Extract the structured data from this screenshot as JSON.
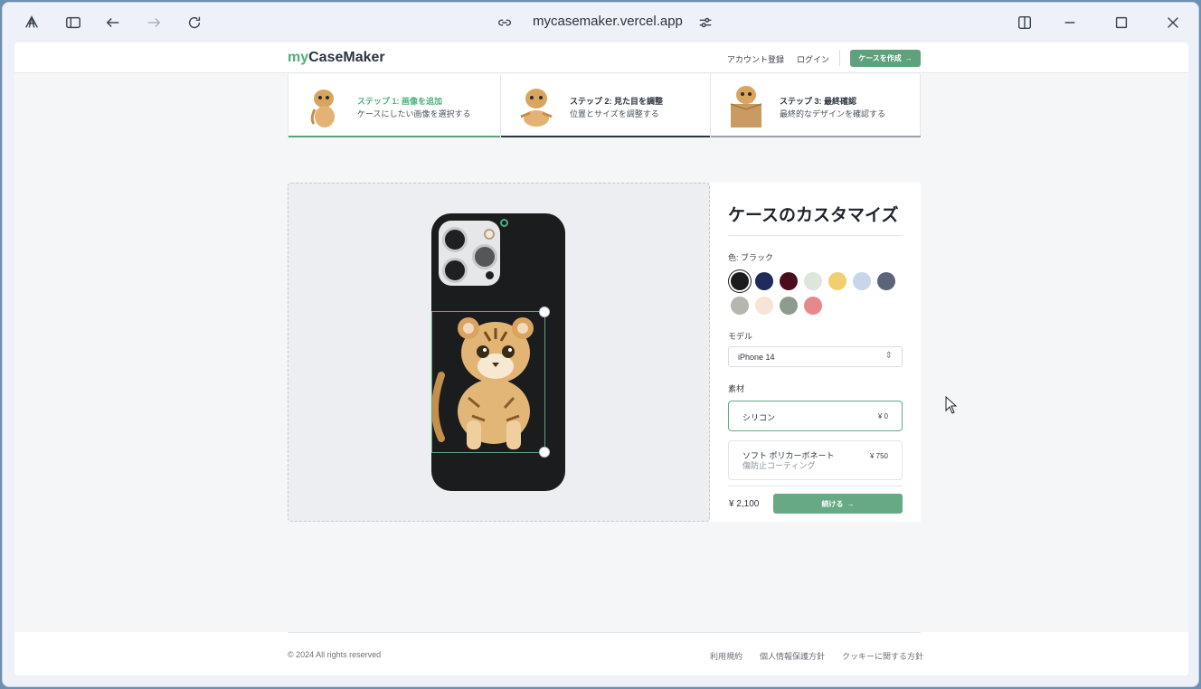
{
  "browser": {
    "url": "mycasemaker.vercel.app"
  },
  "navbar": {
    "logo_prefix": "my",
    "logo_main": "CaseMaker",
    "register_link": "アカウント登録",
    "login_link": "ログイン",
    "create_button": "ケースを作成",
    "create_button_icon": "→"
  },
  "steps": [
    {
      "title": "ステップ 1: 画像を追加",
      "desc": "ケースにしたい画像を選択する",
      "state": "complete",
      "title_color": "#4caf7d",
      "bar_color": "#5ea27d"
    },
    {
      "title": "ステップ 2: 見た目を調整",
      "desc": "位置とサイズを調整する",
      "state": "current",
      "title_color": "#2d3540",
      "bar_color": "#2d3540"
    },
    {
      "title": "ステップ 3: 最終確認",
      "desc": "最終的なデザインを確認する",
      "state": "upcoming",
      "title_color": "#2d3540",
      "bar_color": "#9aa1a9"
    }
  ],
  "panel": {
    "heading": "ケースのカスタマイズ",
    "color_label": "色: ブラック",
    "colors": [
      {
        "name": "black",
        "hex": "#1b1b1d",
        "selected": true
      },
      {
        "name": "navy",
        "hex": "#1f2b5b"
      },
      {
        "name": "burgundy",
        "hex": "#4a0d1e"
      },
      {
        "name": "mint-white",
        "hex": "#dde5dd"
      },
      {
        "name": "yellow",
        "hex": "#f2cf6e"
      },
      {
        "name": "light-blue",
        "hex": "#c8d5ea"
      },
      {
        "name": "slate",
        "hex": "#5b6478"
      },
      {
        "name": "gray",
        "hex": "#b4b7ad"
      },
      {
        "name": "peach",
        "hex": "#f7e4d8"
      },
      {
        "name": "sage",
        "hex": "#8d9c8e"
      },
      {
        "name": "pink",
        "hex": "#e6898d"
      }
    ],
    "model_label": "モデル",
    "model_value": "iPhone 14",
    "material_label": "素材",
    "materials": [
      {
        "name": "シリコン",
        "price": "¥ 0",
        "selected": true
      },
      {
        "name": "ソフト ポリカーボネート",
        "sub": "傷防止コーティング",
        "price": "¥ 750",
        "selected": false
      }
    ],
    "total": "¥ 2,100",
    "continue_button": "続ける",
    "continue_icon": "→"
  },
  "footer": {
    "copyright": "© 2024 All rights reserved",
    "links": [
      "利用規約",
      "個人情報保護方針",
      "クッキーに関する方針"
    ]
  }
}
